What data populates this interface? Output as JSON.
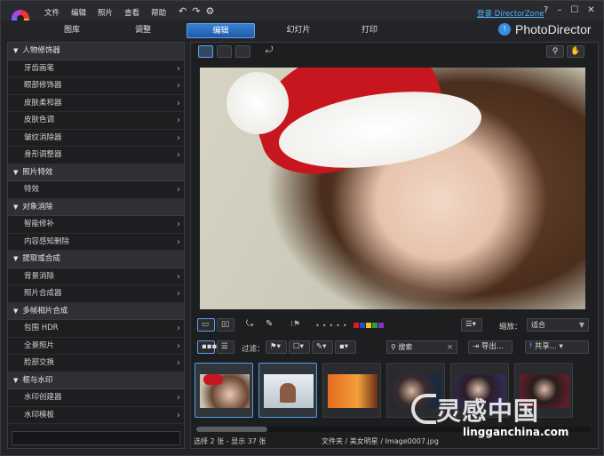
{
  "menu": [
    "文件",
    "编辑",
    "照片",
    "查看",
    "帮助"
  ],
  "login": "登录 DirectorZone",
  "window_buttons": [
    "?",
    "–",
    "☐",
    "✕"
  ],
  "tabs": [
    "图库",
    "调整",
    "编辑",
    "幻灯片",
    "打印"
  ],
  "active_tab": "编辑",
  "brand": "PhotoDirector",
  "sections": [
    {
      "title": "人物修饰器",
      "items": [
        "牙齿画笔",
        "眼部修饰器",
        "皮肤柔和器",
        "皮肤色调",
        "皱纹消除器",
        "身形调整器"
      ]
    },
    {
      "title": "照片特效",
      "items": [
        "特效"
      ]
    },
    {
      "title": "对象消除",
      "items": [
        "智能修补",
        "内容感知删除"
      ]
    },
    {
      "title": "提取或合成",
      "items": [
        "背景消除",
        "照片合成器"
      ]
    },
    {
      "title": "多帧相片合成",
      "items": [
        "包围 HDR",
        "全景照片",
        "脸部交换"
      ]
    },
    {
      "title": "框与水印",
      "items": [
        "水印创建器",
        "水印模板"
      ]
    }
  ],
  "toolbar": {
    "zoom_label": "缩放：",
    "zoom_value": "适合",
    "filter_label": "过滤：",
    "search_placeholder": "搜索",
    "export_label": "导出...",
    "share_label": "共享..."
  },
  "colors": [
    "#d81b1b",
    "#1f4fd8",
    "#f0c419",
    "#2e9e3e",
    "#8a2fc9"
  ],
  "status": {
    "selection": "选择 2 张 - 显示 37 张",
    "path": "文件夹 / 美女明星 / Image0007.jpg"
  },
  "watermark": {
    "cn": "灵感中国",
    "url": "lingganchina.com"
  }
}
